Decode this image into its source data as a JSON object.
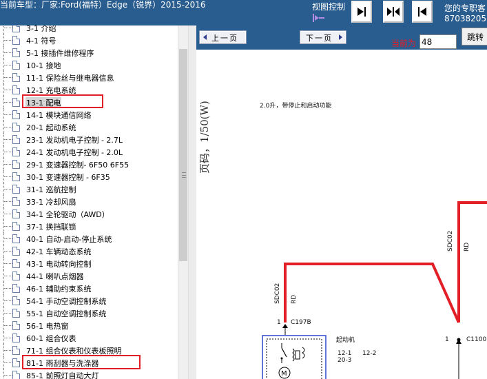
{
  "header": {
    "title": "当前车型：厂家:Ford(福特）Edge（锐界）2015-2016",
    "view_label": "视图控制",
    "consult_line1": "您的专职客",
    "consult_line2": "87038205",
    "view_buttons": [
      "collapse-left-icon",
      "split-view-icon",
      "collapse-right-icon"
    ]
  },
  "tree": {
    "items": [
      {
        "label": "3-1 介绍"
      },
      {
        "label": "4-1 符号"
      },
      {
        "label": "5-1 接插件维修程序"
      },
      {
        "label": "10-1 接地"
      },
      {
        "label": "11-1 保险丝与继电器信息"
      },
      {
        "label": "12-1 充电系统"
      },
      {
        "label": "13-1 配电"
      },
      {
        "label": "14-1 模块通信网络"
      },
      {
        "label": "20-1 起动系统"
      },
      {
        "label": "23-1 发动机电子控制 - 2.7L"
      },
      {
        "label": "24-1 发动机电子控制 - 2.0L"
      },
      {
        "label": "29-1 变速器控制- 6F50 6F55"
      },
      {
        "label": "30-1 变速器控制 - 6F35"
      },
      {
        "label": "31-1 巡航控制"
      },
      {
        "label": "33-1 冷却风扇"
      },
      {
        "label": "34-1 全轮驱动（AWD）"
      },
      {
        "label": "37-1 换挡联锁"
      },
      {
        "label": "40-1 自动-启动-停止系统"
      },
      {
        "label": "42-1 车辆动态系统"
      },
      {
        "label": "43-1 电动转向控制"
      },
      {
        "label": "44-1 喇叭点烟器"
      },
      {
        "label": "46-1 辅助约束系统"
      },
      {
        "label": "54-1 手动空调控制系统"
      },
      {
        "label": "55-1 自动空调控制系统"
      },
      {
        "label": "56-1 电热窗"
      },
      {
        "label": "60-1 组合仪表"
      },
      {
        "label": "71-1 组合仪表和仪表板照明"
      },
      {
        "label": "81-1 雨刮器与洗涤器"
      },
      {
        "label": "85-1 前照灯自动大灯"
      }
    ],
    "selected": "13-1 配电"
  },
  "toolbar": {
    "prev_label": "上一页",
    "next_label": "下一页",
    "current_label": "当前为",
    "page_value": "48",
    "jump_label": "跳转"
  },
  "document": {
    "page_code": "页码，1/50(W)",
    "caption": "2.0升，带停止和启动功能",
    "wire_left_circuit": "SDC02",
    "wire_left_color": "RD",
    "wire_right_circuit": "SDC02",
    "wire_right_color": "RD",
    "pin_left": "1",
    "connector_left": "C197B",
    "starter_label": "起动机",
    "ref_1": "12-1",
    "ref_2": "12-2",
    "ref_3": "20-3",
    "pin_right": "1",
    "connector_right": "C1100"
  },
  "colors": {
    "header_bg": "#2a5d8f",
    "highlight_red": "#e21f26",
    "wire_red": "#e21f26"
  }
}
